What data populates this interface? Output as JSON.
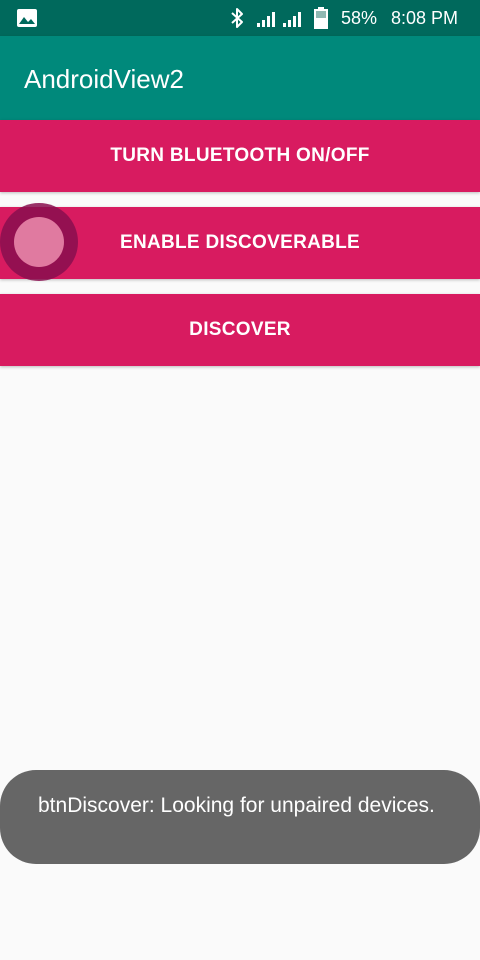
{
  "status_bar": {
    "battery": "58%",
    "time": "8:08 PM",
    "icons": [
      "image-icon",
      "bluetooth-icon",
      "signal-icon",
      "signal-icon",
      "battery-icon"
    ],
    "background_color": "#00695c"
  },
  "app_bar": {
    "title": "AndroidView2",
    "background_color": "#00897b"
  },
  "buttons": [
    {
      "label": "TURN BLUETOOTH ON/OFF"
    },
    {
      "label": "ENABLE DISCOVERABLE"
    },
    {
      "label": "DISCOVER"
    }
  ],
  "button_color": "#d81b60",
  "toast": {
    "message": "btnDiscover: Looking for unpaired devices."
  }
}
